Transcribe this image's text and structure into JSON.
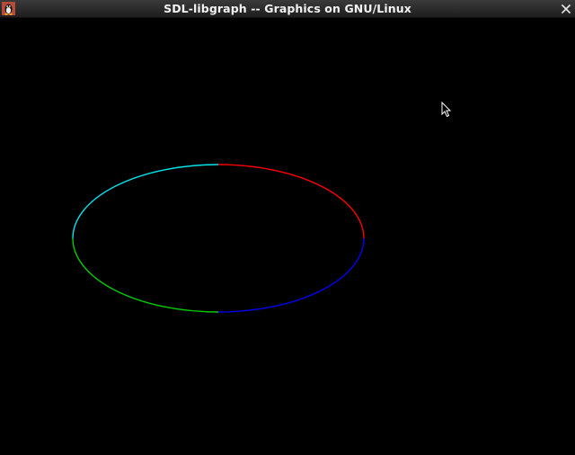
{
  "window": {
    "title": "SDL-libgraph -- Graphics on GNU/Linux",
    "icons": {
      "app": "tux-icon",
      "close": "close-icon",
      "cursor": "mouse-pointer-icon"
    }
  },
  "canvas": {
    "background": "#000000",
    "ellipse": {
      "arcs": [
        {
          "quadrant": "top-right",
          "color": "#ff0000"
        },
        {
          "quadrant": "top-left",
          "color": "#00e5ee"
        },
        {
          "quadrant": "bottom-left",
          "color": "#00cc00"
        },
        {
          "quadrant": "bottom-right",
          "color": "#0000ee"
        }
      ]
    }
  }
}
